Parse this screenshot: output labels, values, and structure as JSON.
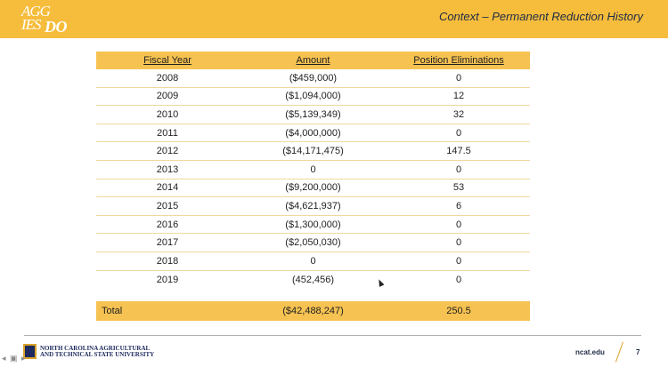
{
  "header": {
    "logo_lines": [
      "AGG",
      "IES",
      "DO"
    ],
    "title": "Context – Permanent Reduction History"
  },
  "table": {
    "headers": [
      "Fiscal Year",
      "Amount",
      "Position Eliminations"
    ],
    "rows": [
      [
        "2008",
        "($459,000)",
        "0"
      ],
      [
        "2009",
        "($1,094,000)",
        "12"
      ],
      [
        "2010",
        "($5,139,349)",
        "32"
      ],
      [
        "2011",
        "($4,000,000)",
        "0"
      ],
      [
        "2012",
        "($14,171,475)",
        "147.5"
      ],
      [
        "2013",
        "0",
        "0"
      ],
      [
        "2014",
        "($9,200,000)",
        "53"
      ],
      [
        "2015",
        "($4,621,937)",
        "6"
      ],
      [
        "2016",
        "($1,300,000)",
        "0"
      ],
      [
        "2017",
        "($2,050,030)",
        "0"
      ],
      [
        "2018",
        "0",
        "0"
      ],
      [
        "2019",
        "(452,456)",
        "0"
      ]
    ],
    "total": [
      "Total",
      "($42,488,247)",
      "250.5"
    ]
  },
  "footer": {
    "university_line1": "North Carolina Agricultural",
    "university_line2": "and Technical State University",
    "site": "ncat.edu",
    "page_number": "7"
  },
  "icons": [
    "university-logo-icon",
    "nav-arrows-icon",
    "mouse-cursor-icon"
  ]
}
